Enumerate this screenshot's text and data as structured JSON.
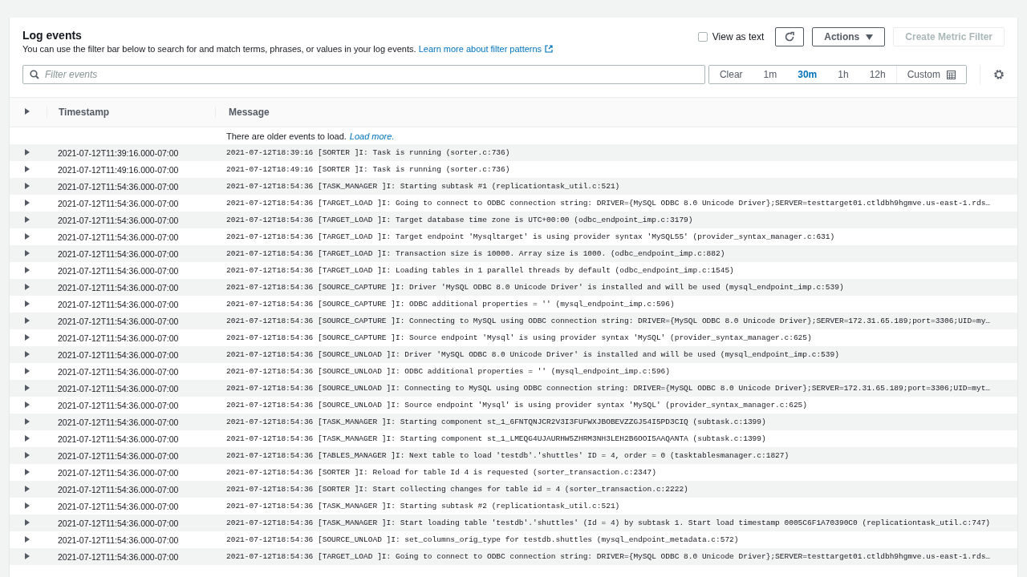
{
  "panel": {
    "title": "Log events",
    "description": "You can use the filter bar below to search for and match terms, phrases, or values in your log events.",
    "learn_more_link": "Learn more about filter patterns"
  },
  "view_as_text": {
    "label": "View as text",
    "checked": false
  },
  "actions": {
    "label": "Actions",
    "create_metric_filter": {
      "label": "Create Metric Filter",
      "disabled": true
    }
  },
  "filter": {
    "placeholder": "Filter events"
  },
  "time_range": [
    {
      "label": "Clear",
      "selected": false
    },
    {
      "label": "1m",
      "selected": false
    },
    {
      "label": "30m",
      "selected": true
    },
    {
      "label": "1h",
      "selected": false
    },
    {
      "label": "12h",
      "selected": false
    },
    {
      "label": "Custom",
      "selected": false
    }
  ],
  "table": {
    "columns": [
      "Timestamp",
      "Message"
    ],
    "older_events": {
      "text": "There are older events to load.",
      "link": "Load more."
    },
    "rows": [
      {
        "timestamp": "2021-07-12T11:39:16.000-07:00",
        "message": "2021-07-12T18:39:16 [SORTER ]I: Task is running (sorter.c:736)",
        "expanded": false
      },
      {
        "timestamp": "2021-07-12T11:49:16.000-07:00",
        "message": "2021-07-12T18:49:16 [SORTER ]I: Task is running (sorter.c:736)",
        "expanded": false
      },
      {
        "timestamp": "2021-07-12T11:54:36.000-07:00",
        "message": "2021-07-12T18:54:36 [TASK_MANAGER ]I: Starting subtask #1 (replicationtask_util.c:521)",
        "expanded": false
      },
      {
        "timestamp": "2021-07-12T11:54:36.000-07:00",
        "message": "2021-07-12T18:54:36 [TARGET_LOAD ]I: Going to connect to ODBC connection string: DRIVER={MySQL ODBC 8.0 Unicode Driver};SERVER=testtarget01.ctldbh9hgmve.us-east-1.rds…",
        "expanded": false
      },
      {
        "timestamp": "2021-07-12T11:54:36.000-07:00",
        "message": "2021-07-12T18:54:36 [TARGET_LOAD ]I: Target database time zone is UTC+00:00 (odbc_endpoint_imp.c:3179)",
        "expanded": false
      },
      {
        "timestamp": "2021-07-12T11:54:36.000-07:00",
        "message": "2021-07-12T18:54:36 [TARGET_LOAD ]I: Target endpoint 'Mysqltarget' is using provider syntax 'MySQL55' (provider_syntax_manager.c:631)",
        "expanded": false
      },
      {
        "timestamp": "2021-07-12T11:54:36.000-07:00",
        "message": "2021-07-12T18:54:36 [TARGET_LOAD ]I: Transaction size is 10000. Array size is 1000. (odbc_endpoint_imp.c:882)",
        "expanded": false
      },
      {
        "timestamp": "2021-07-12T11:54:36.000-07:00",
        "message": "2021-07-12T18:54:36 [TARGET_LOAD ]I: Loading tables in 1 parallel threads by default (odbc_endpoint_imp.c:1545)",
        "expanded": false
      },
      {
        "timestamp": "2021-07-12T11:54:36.000-07:00",
        "message": "2021-07-12T18:54:36 [SOURCE_CAPTURE ]I: Driver 'MySQL ODBC 8.0 Unicode Driver' is installed and will be used (mysql_endpoint_imp.c:539)",
        "expanded": false
      },
      {
        "timestamp": "2021-07-12T11:54:36.000-07:00",
        "message": "2021-07-12T18:54:36 [SOURCE_CAPTURE ]I: ODBC additional properties = '' (mysql_endpoint_imp.c:596)",
        "expanded": false
      },
      {
        "timestamp": "2021-07-12T11:54:36.000-07:00",
        "message": "2021-07-12T18:54:36 [SOURCE_CAPTURE ]I: Connecting to MySQL using ODBC connection string: DRIVER={MySQL ODBC 8.0 Unicode Driver};SERVER=172.31.65.189;port=3306;UID=my…",
        "expanded": false
      },
      {
        "timestamp": "2021-07-12T11:54:36.000-07:00",
        "message": "2021-07-12T18:54:36 [SOURCE_CAPTURE ]I: Source endpoint 'Mysql' is using provider syntax 'MySQL' (provider_syntax_manager.c:625)",
        "expanded": false
      },
      {
        "timestamp": "2021-07-12T11:54:36.000-07:00",
        "message": "2021-07-12T18:54:36 [SOURCE_UNLOAD ]I: Driver 'MySQL ODBC 8.0 Unicode Driver' is installed and will be used (mysql_endpoint_imp.c:539)",
        "expanded": false
      },
      {
        "timestamp": "2021-07-12T11:54:36.000-07:00",
        "message": "2021-07-12T18:54:36 [SOURCE_UNLOAD ]I: ODBC additional properties = '' (mysql_endpoint_imp.c:596)",
        "expanded": false
      },
      {
        "timestamp": "2021-07-12T11:54:36.000-07:00",
        "message": "2021-07-12T18:54:36 [SOURCE_UNLOAD ]I: Connecting to MySQL using ODBC connection string: DRIVER={MySQL ODBC 8.0 Unicode Driver};SERVER=172.31.65.189;port=3306;UID=myt…",
        "expanded": false
      },
      {
        "timestamp": "2021-07-12T11:54:36.000-07:00",
        "message": "2021-07-12T18:54:36 [SOURCE_UNLOAD ]I: Source endpoint 'Mysql' is using provider syntax 'MySQL' (provider_syntax_manager.c:625)",
        "expanded": false
      },
      {
        "timestamp": "2021-07-12T11:54:36.000-07:00",
        "message": "2021-07-12T18:54:36 [TASK_MANAGER ]I: Starting component st_1_6FNTQNJCR2V3I3FUFWXJBOBEVZZGJ54I5PD3CIQ (subtask.c:1399)",
        "expanded": false
      },
      {
        "timestamp": "2021-07-12T11:54:36.000-07:00",
        "message": "2021-07-12T18:54:36 [TASK_MANAGER ]I: Starting component st_1_LMEQG4UJAURHW5ZHRM3NH3LEH2B6OOI5AAQANTA (subtask.c:1399)",
        "expanded": false
      },
      {
        "timestamp": "2021-07-12T11:54:36.000-07:00",
        "message": "2021-07-12T18:54:36 [TABLES_MANAGER ]I: Next table to load 'testdb'.'shuttles' ID = 4, order = 0 (tasktablesmanager.c:1827)",
        "expanded": false
      },
      {
        "timestamp": "2021-07-12T11:54:36.000-07:00",
        "message": "2021-07-12T18:54:36 [SORTER ]I: Reload for table Id 4 is requested (sorter_transaction.c:2347)",
        "expanded": false
      },
      {
        "timestamp": "2021-07-12T11:54:36.000-07:00",
        "message": "2021-07-12T18:54:36 [SORTER ]I: Start collecting changes for table id = 4 (sorter_transaction.c:2222)",
        "expanded": false
      },
      {
        "timestamp": "2021-07-12T11:54:36.000-07:00",
        "message": "2021-07-12T18:54:36 [TASK_MANAGER ]I: Starting subtask #2 (replicationtask_util.c:521)",
        "expanded": false
      },
      {
        "timestamp": "2021-07-12T11:54:36.000-07:00",
        "message": "2021-07-12T18:54:36 [TASK_MANAGER ]I: Start loading table 'testdb'.'shuttles' (Id = 4) by subtask 1. Start load timestamp 0005C6F1A70390C0 (replicationtask_util.c:747)",
        "expanded": false
      },
      {
        "timestamp": "2021-07-12T11:54:36.000-07:00",
        "message": "2021-07-12T18:54:36 [SOURCE_UNLOAD ]I: set_columns_orig_type for testdb.shuttles (mysql_endpoint_metadata.c:572)",
        "expanded": false
      },
      {
        "timestamp": "2021-07-12T11:54:36.000-07:00",
        "message": "2021-07-12T18:54:36 [TARGET_LOAD ]I: Going to connect to ODBC connection string: DRIVER={MySQL ODBC 8.0 Unicode Driver};SERVER=testtarget01.ctldbh9hgmve.us-east-1.rds…",
        "expanded": false
      }
    ]
  }
}
